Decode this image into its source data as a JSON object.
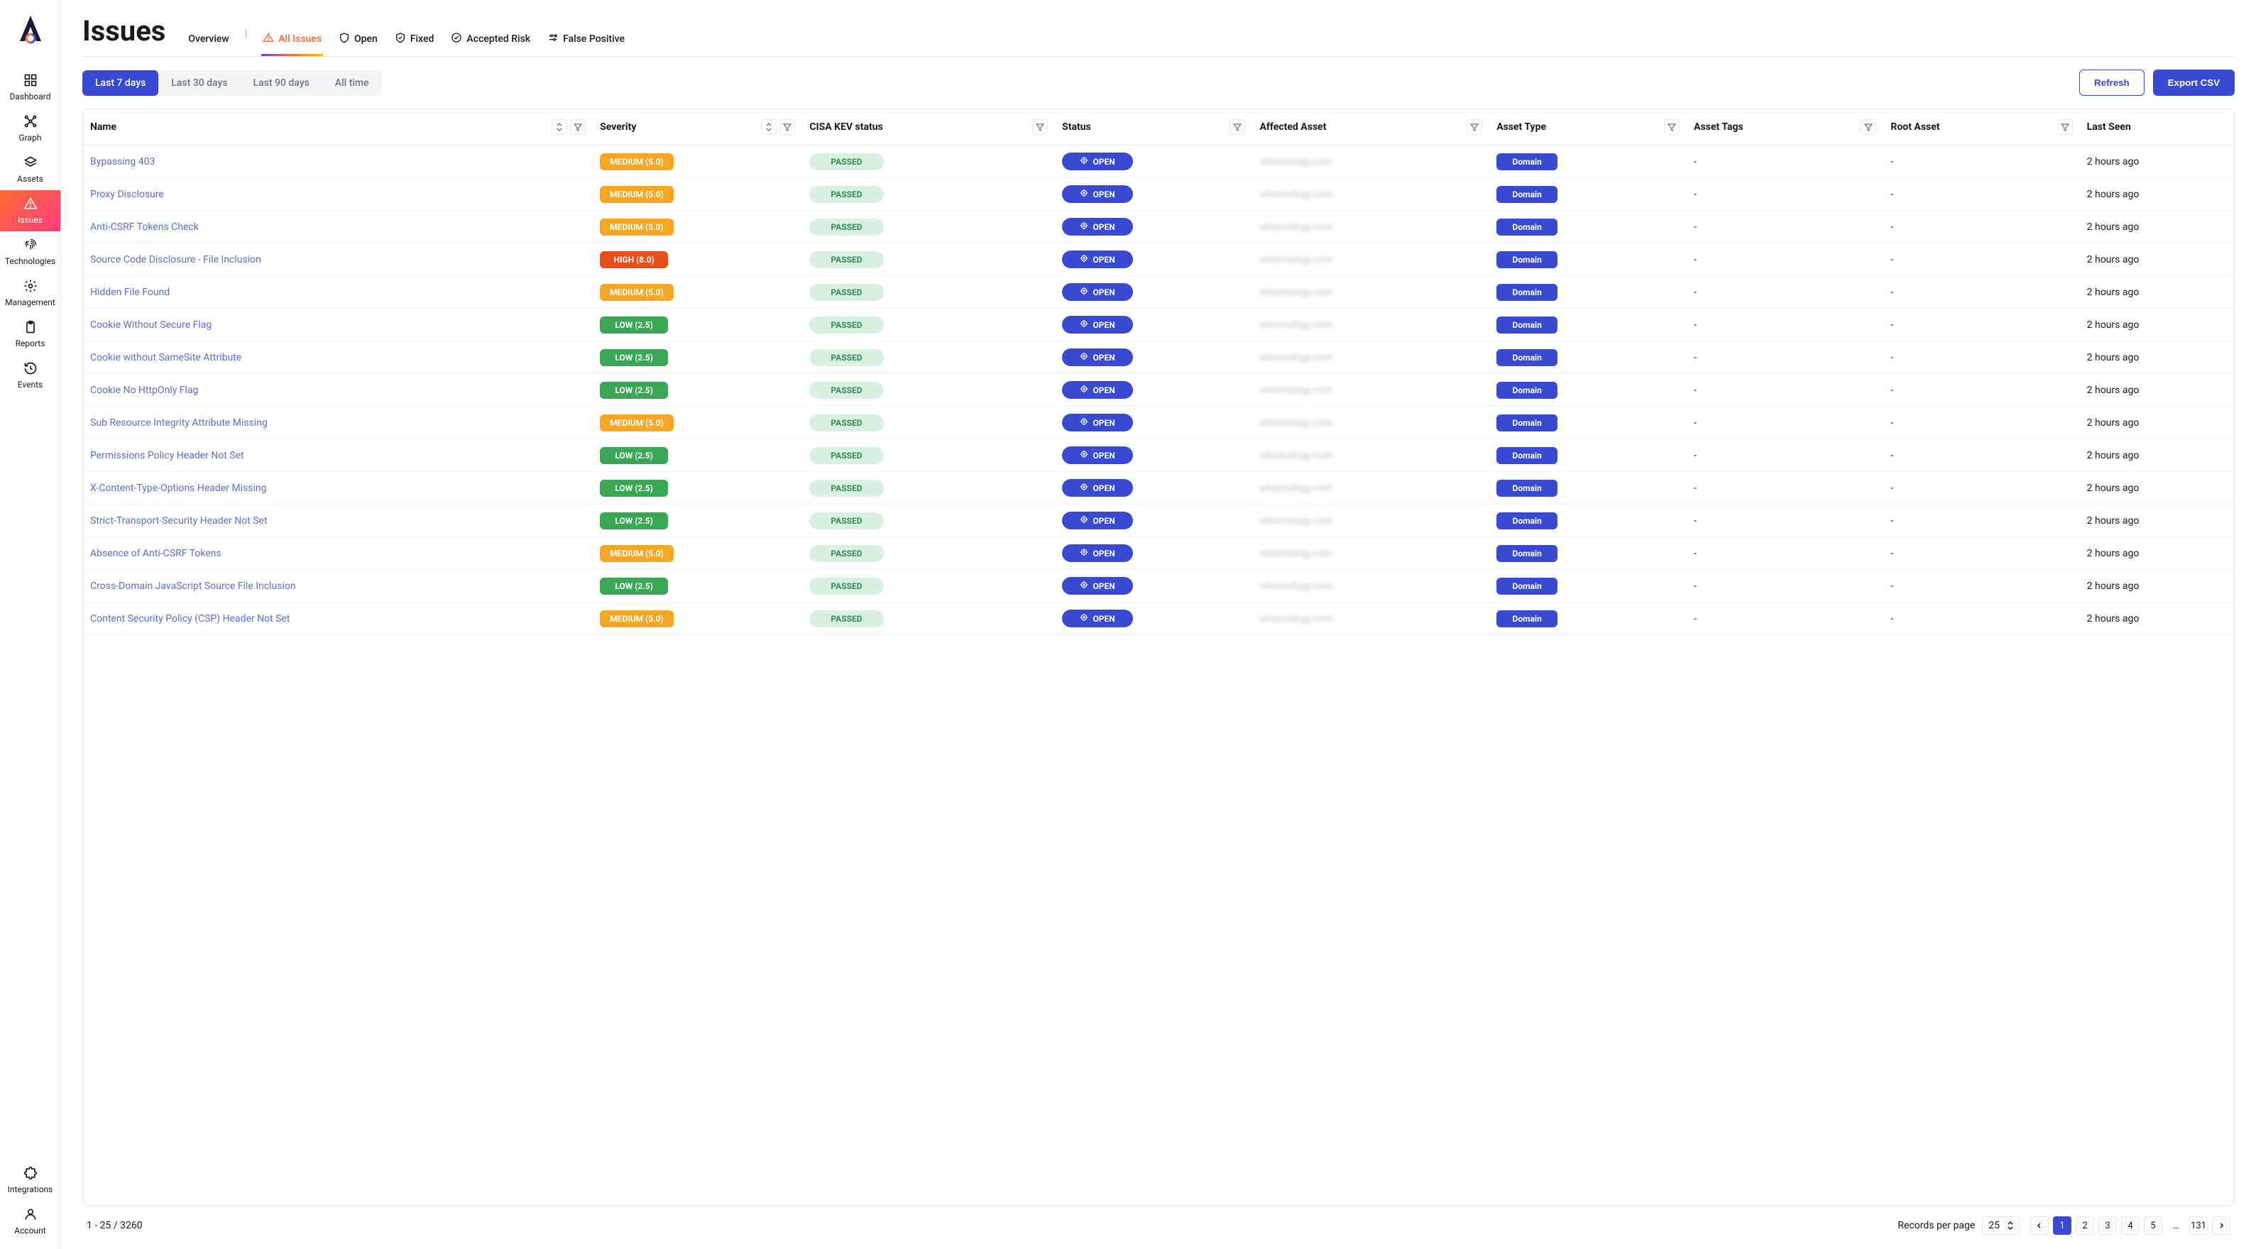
{
  "sidebar": {
    "items": [
      {
        "label": "Dashboard",
        "icon": "grid"
      },
      {
        "label": "Graph",
        "icon": "graph"
      },
      {
        "label": "Assets",
        "icon": "layers"
      },
      {
        "label": "Issues",
        "icon": "alert",
        "active": true
      },
      {
        "label": "Technologies",
        "icon": "fingerprint"
      },
      {
        "label": "Management",
        "icon": "gear"
      },
      {
        "label": "Reports",
        "icon": "clipboard"
      },
      {
        "label": "Events",
        "icon": "history"
      }
    ],
    "bottom": [
      {
        "label": "Integrations",
        "icon": "puzzle"
      },
      {
        "label": "Account",
        "icon": "person"
      }
    ]
  },
  "page": {
    "title": "Issues"
  },
  "tabs": [
    {
      "label": "Overview",
      "icon": null
    },
    {
      "label": "All Issues",
      "icon": "alert",
      "active": true
    },
    {
      "label": "Open",
      "icon": "shield"
    },
    {
      "label": "Fixed",
      "icon": "shield-check"
    },
    {
      "label": "Accepted Risk",
      "icon": "badge-check"
    },
    {
      "label": "False Positive",
      "icon": "adjust"
    }
  ],
  "timeFilters": [
    {
      "label": "Last 7 days",
      "active": true
    },
    {
      "label": "Last 30 days"
    },
    {
      "label": "Last 90 days"
    },
    {
      "label": "All time"
    }
  ],
  "actions": {
    "refresh": "Refresh",
    "export": "Export CSV"
  },
  "columns": [
    {
      "label": "Name",
      "sort": true,
      "filter": true
    },
    {
      "label": "Severity",
      "sort": true,
      "filter": true
    },
    {
      "label": "CISA KEV status",
      "filter": true
    },
    {
      "label": "Status",
      "filter": true
    },
    {
      "label": "Affected Asset",
      "filter": true
    },
    {
      "label": "Asset Type",
      "filter": true
    },
    {
      "label": "Asset Tags",
      "filter": true
    },
    {
      "label": "Root Asset",
      "filter": true
    },
    {
      "label": "Last Seen"
    }
  ],
  "rows": [
    {
      "name": "Bypassing 403",
      "severity": {
        "label": "MEDIUM (5.0)",
        "level": "medium"
      },
      "kev": "PASSED",
      "status": "OPEN",
      "affected": "whomology.com",
      "assetType": "Domain",
      "assetTags": "-",
      "rootAsset": "-",
      "lastSeen": "2 hours ago"
    },
    {
      "name": "Proxy Disclosure",
      "severity": {
        "label": "MEDIUM (5.0)",
        "level": "medium"
      },
      "kev": "PASSED",
      "status": "OPEN",
      "affected": "whomology.com",
      "assetType": "Domain",
      "assetTags": "-",
      "rootAsset": "-",
      "lastSeen": "2 hours ago"
    },
    {
      "name": "Anti-CSRF Tokens Check",
      "severity": {
        "label": "MEDIUM (5.0)",
        "level": "medium"
      },
      "kev": "PASSED",
      "status": "OPEN",
      "affected": "whomology.com",
      "assetType": "Domain",
      "assetTags": "-",
      "rootAsset": "-",
      "lastSeen": "2 hours ago"
    },
    {
      "name": "Source Code Disclosure - File Inclusion",
      "severity": {
        "label": "HIGH (8.0)",
        "level": "high"
      },
      "kev": "PASSED",
      "status": "OPEN",
      "affected": "whomology.com",
      "assetType": "Domain",
      "assetTags": "-",
      "rootAsset": "-",
      "lastSeen": "2 hours ago"
    },
    {
      "name": "Hidden File Found",
      "severity": {
        "label": "MEDIUM (5.0)",
        "level": "medium"
      },
      "kev": "PASSED",
      "status": "OPEN",
      "affected": "whomology.com",
      "assetType": "Domain",
      "assetTags": "-",
      "rootAsset": "-",
      "lastSeen": "2 hours ago"
    },
    {
      "name": "Cookie Without Secure Flag",
      "severity": {
        "label": "LOW (2.5)",
        "level": "low"
      },
      "kev": "PASSED",
      "status": "OPEN",
      "affected": "whomology.com",
      "assetType": "Domain",
      "assetTags": "-",
      "rootAsset": "-",
      "lastSeen": "2 hours ago"
    },
    {
      "name": "Cookie without SameSite Attribute",
      "severity": {
        "label": "LOW (2.5)",
        "level": "low"
      },
      "kev": "PASSED",
      "status": "OPEN",
      "affected": "whomology.com",
      "assetType": "Domain",
      "assetTags": "-",
      "rootAsset": "-",
      "lastSeen": "2 hours ago"
    },
    {
      "name": "Cookie No HttpOnly Flag",
      "severity": {
        "label": "LOW (2.5)",
        "level": "low"
      },
      "kev": "PASSED",
      "status": "OPEN",
      "affected": "whomology.com",
      "assetType": "Domain",
      "assetTags": "-",
      "rootAsset": "-",
      "lastSeen": "2 hours ago"
    },
    {
      "name": "Sub Resource Integrity Attribute Missing",
      "severity": {
        "label": "MEDIUM (5.0)",
        "level": "medium"
      },
      "kev": "PASSED",
      "status": "OPEN",
      "affected": "whomology.com",
      "assetType": "Domain",
      "assetTags": "-",
      "rootAsset": "-",
      "lastSeen": "2 hours ago"
    },
    {
      "name": "Permissions Policy Header Not Set",
      "severity": {
        "label": "LOW (2.5)",
        "level": "low"
      },
      "kev": "PASSED",
      "status": "OPEN",
      "affected": "whomology.com",
      "assetType": "Domain",
      "assetTags": "-",
      "rootAsset": "-",
      "lastSeen": "2 hours ago"
    },
    {
      "name": "X-Content-Type-Options Header Missing",
      "severity": {
        "label": "LOW (2.5)",
        "level": "low"
      },
      "kev": "PASSED",
      "status": "OPEN",
      "affected": "whomology.com",
      "assetType": "Domain",
      "assetTags": "-",
      "rootAsset": "-",
      "lastSeen": "2 hours ago"
    },
    {
      "name": "Strict-Transport-Security Header Not Set",
      "severity": {
        "label": "LOW (2.5)",
        "level": "low"
      },
      "kev": "PASSED",
      "status": "OPEN",
      "affected": "whomology.com",
      "assetType": "Domain",
      "assetTags": "-",
      "rootAsset": "-",
      "lastSeen": "2 hours ago"
    },
    {
      "name": "Absence of Anti-CSRF Tokens",
      "severity": {
        "label": "MEDIUM (5.0)",
        "level": "medium"
      },
      "kev": "PASSED",
      "status": "OPEN",
      "affected": "whomology.com",
      "assetType": "Domain",
      "assetTags": "-",
      "rootAsset": "-",
      "lastSeen": "2 hours ago"
    },
    {
      "name": "Cross-Domain JavaScript Source File Inclusion",
      "severity": {
        "label": "LOW (2.5)",
        "level": "low"
      },
      "kev": "PASSED",
      "status": "OPEN",
      "affected": "whomology.com",
      "assetType": "Domain",
      "assetTags": "-",
      "rootAsset": "-",
      "lastSeen": "2 hours ago"
    },
    {
      "name": "Content Security Policy (CSP) Header Not Set",
      "severity": {
        "label": "MEDIUM (5.0)",
        "level": "medium"
      },
      "kev": "PASSED",
      "status": "OPEN",
      "affected": "whomology.com",
      "assetType": "Domain",
      "assetTags": "-",
      "rootAsset": "-",
      "lastSeen": "2 hours ago"
    }
  ],
  "footer": {
    "range": "1 - 25 / 3260",
    "rppLabel": "Records per page",
    "rppValue": "25",
    "pages": [
      "1",
      "2",
      "3",
      "4",
      "5",
      "…",
      "131"
    ],
    "activePage": "1"
  }
}
